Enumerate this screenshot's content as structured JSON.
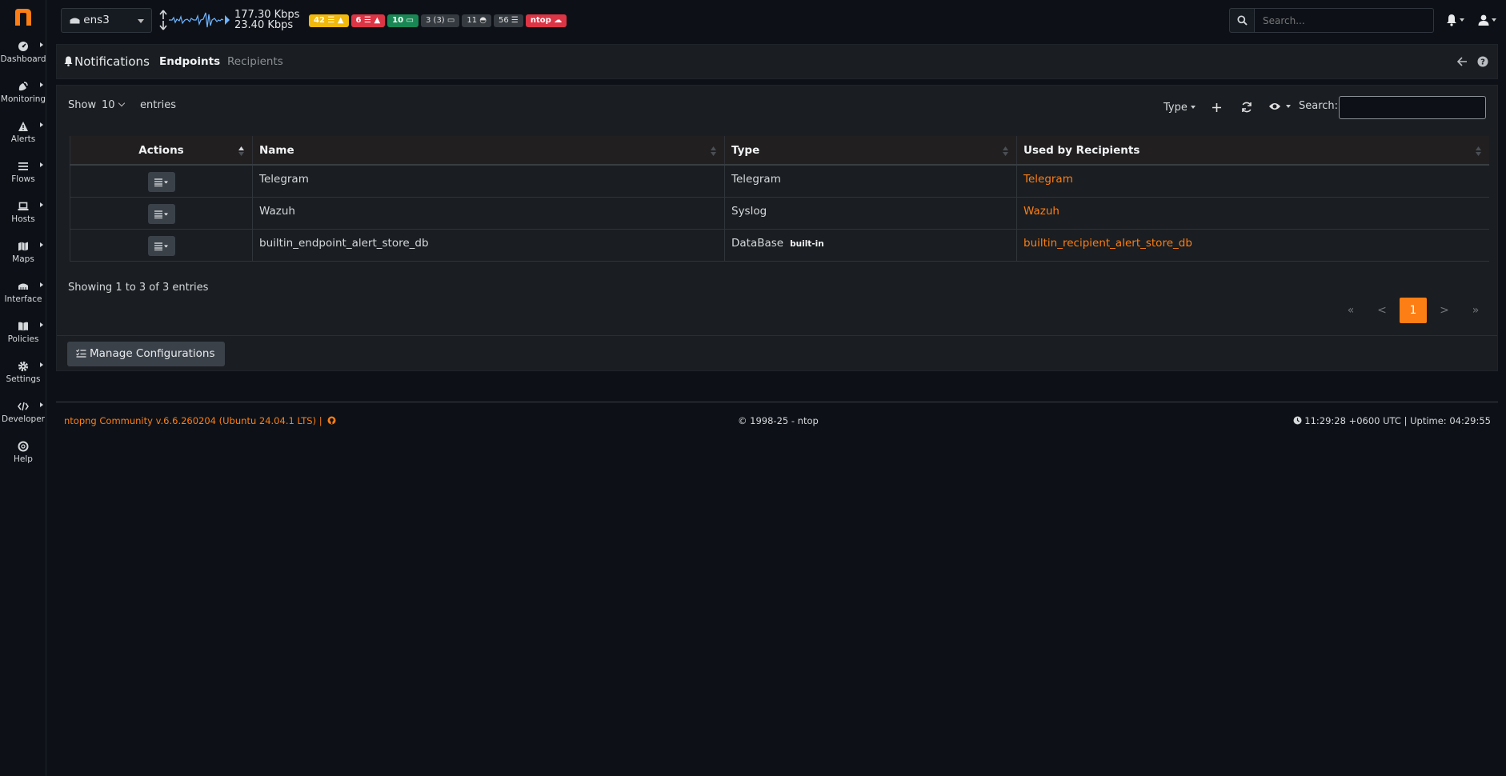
{
  "sidebar": {
    "items": [
      {
        "label": "Dashboard",
        "icon": "gauge-icon"
      },
      {
        "label": "Monitoring",
        "icon": "satellite-dish-icon"
      },
      {
        "label": "Alerts",
        "icon": "warning-triangle-icon"
      },
      {
        "label": "Flows",
        "icon": "list-lines-icon"
      },
      {
        "label": "Hosts",
        "icon": "laptop-icon"
      },
      {
        "label": "Maps",
        "icon": "map-icon"
      },
      {
        "label": "Interface",
        "icon": "ethernet-icon"
      },
      {
        "label": "Policies",
        "icon": "book-icon"
      },
      {
        "label": "Settings",
        "icon": "gear-icon"
      },
      {
        "label": "Developer",
        "icon": "code-icon"
      },
      {
        "label": "Help",
        "icon": "life-ring-icon"
      }
    ]
  },
  "topbar": {
    "interface": "ens3",
    "rate_up": "177.30 Kbps",
    "rate_down": "23.40 Kbps",
    "badges": [
      {
        "text": "42",
        "color": "#f1b80d"
      },
      {
        "text": "6",
        "color": "#dc3545"
      },
      {
        "text": "10",
        "color": "#198754"
      },
      {
        "text": "3 (3)",
        "color": "#343a40"
      },
      {
        "text": "11",
        "color": "#343a40"
      },
      {
        "text": "56",
        "color": "#343a40"
      },
      {
        "text": "ntop",
        "color": "#dc3545"
      }
    ],
    "search_placeholder": "Search..."
  },
  "header": {
    "title": "Notifications",
    "tabs": [
      {
        "label": "Endpoints",
        "active": true
      },
      {
        "label": "Recipients",
        "active": false
      }
    ]
  },
  "table_controls": {
    "show_label": "Show",
    "page_length": "10",
    "entries_label": "entries",
    "type_filter": "Type",
    "search_label": "Search:"
  },
  "table": {
    "columns": [
      "Actions",
      "Name",
      "Type",
      "Used by Recipients"
    ],
    "rows": [
      {
        "name": "Telegram",
        "type": "Telegram",
        "badge": "",
        "recipients": "Telegram"
      },
      {
        "name": "Wazuh",
        "type": "Syslog",
        "badge": "",
        "recipients": "Wazuh"
      },
      {
        "name": "builtin_endpoint_alert_store_db",
        "type": "DataBase",
        "badge": "built-in",
        "recipients": "builtin_recipient_alert_store_db"
      }
    ]
  },
  "pagination": {
    "info": "Showing 1 to 3 of 3 entries",
    "first": "«",
    "prev": "<",
    "current": "1",
    "next": ">",
    "last": "»"
  },
  "manage_button": "Manage Configurations",
  "footer": {
    "version": "ntopng Community v.6.6.260204 (Ubuntu 24.04.1 LTS) |",
    "copyright": "© 1998-25 - ntop",
    "status": "11:29:28 +0600 UTC | Uptime: 04:29:55"
  },
  "colors": {
    "accent": "#fd7e14",
    "background": "#0d1117",
    "panel": "#1a1d21"
  }
}
